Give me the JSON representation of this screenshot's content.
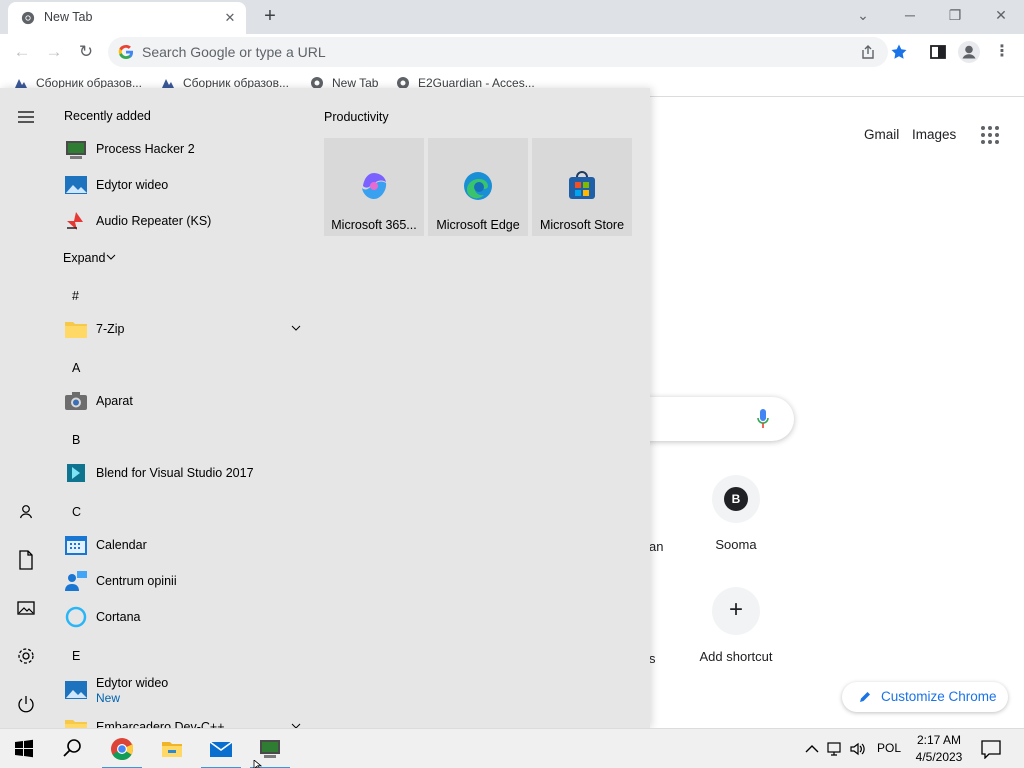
{
  "browser": {
    "tab_title": "New Tab",
    "omnibox_placeholder": "Search Google or type a URL",
    "bookmarks": [
      "Сборник образов...",
      "Сборник образов...",
      "New Tab",
      "E2Guardian - Acces..."
    ]
  },
  "ntp": {
    "links": {
      "gmail": "Gmail",
      "images": "Images"
    },
    "shortcuts": [
      {
        "letter": "B",
        "label": "Sooma"
      },
      {
        "label": "Add shortcut"
      }
    ],
    "partial_labels": [
      "an",
      "s"
    ],
    "customize": "Customize Chrome"
  },
  "start_menu": {
    "recently_added_title": "Recently added",
    "recent_apps": [
      "Process Hacker 2",
      "Edytor wideo",
      "Audio Repeater (KS)"
    ],
    "expand_label": "Expand",
    "groups": [
      {
        "letter": "#",
        "apps": [
          {
            "name": "7-Zip",
            "folder": true
          }
        ]
      },
      {
        "letter": "A",
        "apps": [
          {
            "name": "Aparat"
          }
        ]
      },
      {
        "letter": "B",
        "apps": [
          {
            "name": "Blend for Visual Studio 2017"
          }
        ]
      },
      {
        "letter": "C",
        "apps": [
          {
            "name": "Calendar"
          },
          {
            "name": "Centrum opinii"
          },
          {
            "name": "Cortana"
          }
        ]
      },
      {
        "letter": "E",
        "apps": [
          {
            "name": "Edytor wideo",
            "badge": "New"
          },
          {
            "name": "Embarcadero Dev-C++",
            "folder": true
          }
        ]
      }
    ],
    "productivity_title": "Productivity",
    "tiles": [
      "Microsoft 365...",
      "Microsoft Edge",
      "Microsoft Store"
    ]
  },
  "taskbar": {
    "language": "POL",
    "time": "2:17 AM",
    "date": "4/5/2023"
  },
  "colors": {
    "accent_blue": "#1a73e8",
    "start_menu_bg": "#e6e6e6",
    "taskbar_bg": "#f0f0f0",
    "new_badge": "#0063b1"
  }
}
